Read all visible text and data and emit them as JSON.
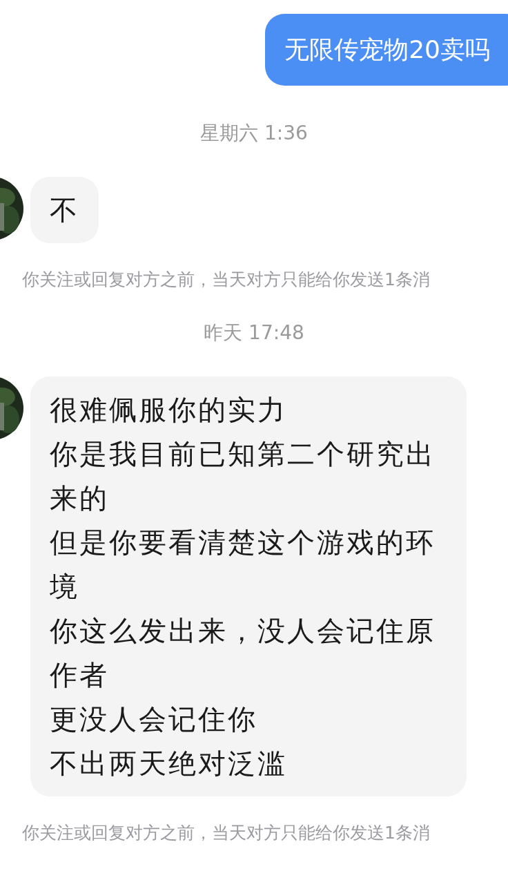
{
  "messages": [
    {
      "kind": "sent",
      "lines": [
        "无限传宠物20卖吗"
      ]
    },
    {
      "kind": "time",
      "text": "星期六 1:36"
    },
    {
      "kind": "received",
      "lines": [
        "不"
      ]
    },
    {
      "kind": "notice",
      "text": "你关注或回复对方之前，当天对方只能给你发送1条消"
    },
    {
      "kind": "time",
      "text": "昨天 17:48"
    },
    {
      "kind": "received",
      "lines": [
        "很难佩服你的实力",
        "你是我目前已知第二个研究出来的",
        "但是你要看清楚这个游戏的环境",
        "你这么发出来，没人会记住原作者",
        "更没人会记住你",
        "不出两天绝对泛滥"
      ]
    },
    {
      "kind": "notice",
      "text": "你关注或回复对方之前，当天对方只能给你发送1条消"
    }
  ]
}
